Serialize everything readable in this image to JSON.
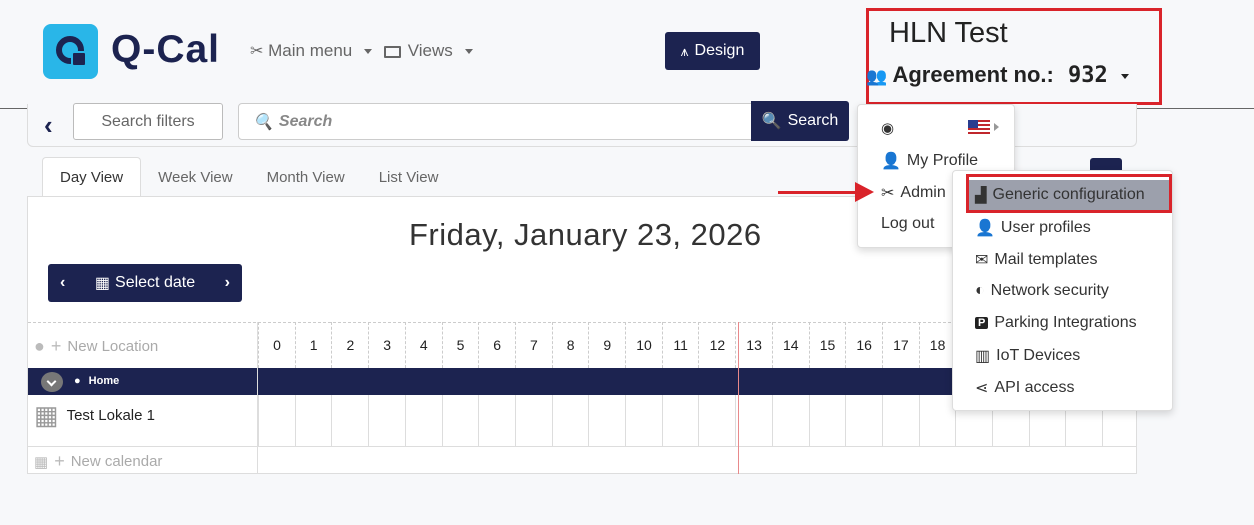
{
  "header": {
    "logo_text": "Q-Cal",
    "main_menu_label": "Main menu",
    "views_label": "Views",
    "design_label": "Design",
    "account_name": "HLN Test",
    "agreement_label": "Agreement no.:",
    "agreement_number": "932"
  },
  "search": {
    "filters_label": "Search filters",
    "placeholder": "Search",
    "button_label": "Search"
  },
  "tabs": [
    {
      "label": "Day View",
      "active": true
    },
    {
      "label": "Week View",
      "active": false
    },
    {
      "label": "Month View",
      "active": false
    },
    {
      "label": "List View",
      "active": false
    }
  ],
  "calendar": {
    "date_title": "Friday, January 23, 2026",
    "select_date_label": "Select date",
    "new_location_label": "New Location",
    "hours": [
      "0",
      "1",
      "2",
      "3",
      "4",
      "5",
      "6",
      "7",
      "8",
      "9",
      "10",
      "11",
      "12",
      "13",
      "14",
      "15",
      "16",
      "17",
      "18"
    ],
    "location_name": "Home",
    "calendar_name": "Test Lokale 1",
    "new_calendar_label": "New calendar"
  },
  "user_menu": {
    "items": [
      {
        "label": "My Profile"
      },
      {
        "label": "Admin"
      },
      {
        "label": "Log out"
      }
    ]
  },
  "admin_menu": {
    "items": [
      {
        "label": "Generic configuration",
        "icon": "factory-icon"
      },
      {
        "label": "User profiles",
        "icon": "user-shield-icon"
      },
      {
        "label": "Mail templates",
        "icon": "mail-bulk-icon"
      },
      {
        "label": "Network security",
        "icon": "shield-icon"
      },
      {
        "label": "Parking Integrations",
        "icon": "parking-icon"
      },
      {
        "label": "IoT Devices",
        "icon": "microchip-icon"
      },
      {
        "label": "API access",
        "icon": "share-icon"
      }
    ]
  },
  "colors": {
    "brand_navy": "#1c2350",
    "logo_cyan": "#29b6e8",
    "highlight_red": "#d9232a",
    "current_time_line": "#e8898b"
  }
}
